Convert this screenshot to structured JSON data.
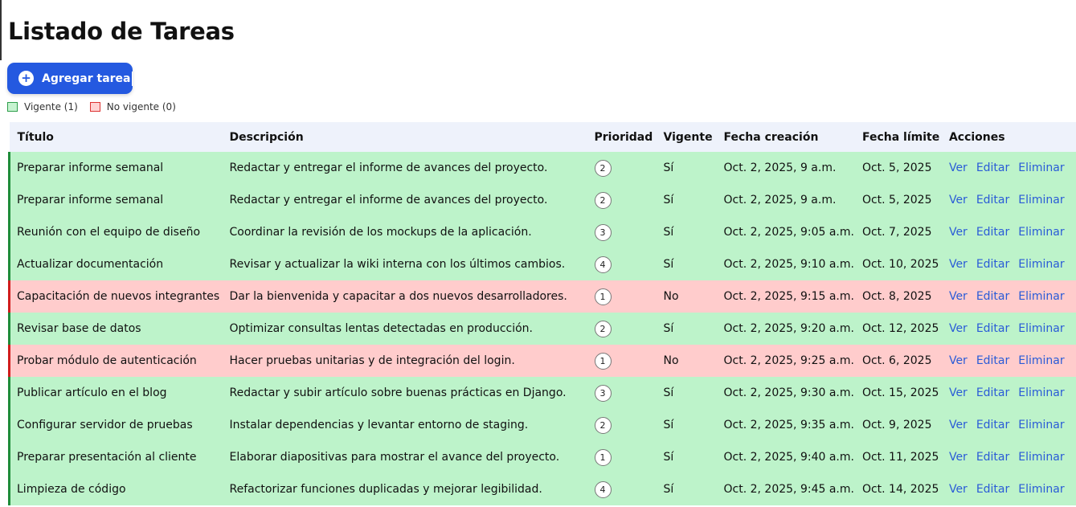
{
  "page": {
    "title": "Listado de Tareas"
  },
  "add_button": {
    "label": "Agregar tarea",
    "icon": "plus-circle-icon"
  },
  "legend": {
    "vigente": "Vigente (1)",
    "no_vigente": "No vigente (0)"
  },
  "colors": {
    "accent": "#2459e0",
    "vigente_bg": "#bdf3ca",
    "no_vigente_bg": "#ffcccc",
    "link": "#2a5bd7"
  },
  "table": {
    "headers": {
      "titulo": "Título",
      "descripcion": "Descripción",
      "prioridad": "Prioridad",
      "vigente": "Vigente",
      "fecha_creacion": "Fecha creación",
      "fecha_limite": "Fecha límite",
      "acciones": "Acciones"
    },
    "actions": {
      "ver": "Ver",
      "editar": "Editar",
      "eliminar": "Eliminar"
    },
    "rows": [
      {
        "titulo": "Preparar informe semanal",
        "descripcion": "Redactar y entregar el informe de avances del proyecto.",
        "prioridad": "2",
        "vigente": "Sí",
        "fecha_creacion": "Oct. 2, 2025, 9 a.m.",
        "fecha_limite": "Oct. 5, 2025",
        "estado": "green"
      },
      {
        "titulo": "Preparar informe semanal",
        "descripcion": "Redactar y entregar el informe de avances del proyecto.",
        "prioridad": "2",
        "vigente": "Sí",
        "fecha_creacion": "Oct. 2, 2025, 9 a.m.",
        "fecha_limite": "Oct. 5, 2025",
        "estado": "green"
      },
      {
        "titulo": "Reunión con el equipo de diseño",
        "descripcion": "Coordinar la revisión de los mockups de la aplicación.",
        "prioridad": "3",
        "vigente": "Sí",
        "fecha_creacion": "Oct. 2, 2025, 9:05 a.m.",
        "fecha_limite": "Oct. 7, 2025",
        "estado": "green"
      },
      {
        "titulo": "Actualizar documentación",
        "descripcion": "Revisar y actualizar la wiki interna con los últimos cambios.",
        "prioridad": "4",
        "vigente": "Sí",
        "fecha_creacion": "Oct. 2, 2025, 9:10 a.m.",
        "fecha_limite": "Oct. 10, 2025",
        "estado": "green"
      },
      {
        "titulo": "Capacitación de nuevos integrantes",
        "descripcion": "Dar la bienvenida y capacitar a dos nuevos desarrolladores.",
        "prioridad": "1",
        "vigente": "No",
        "fecha_creacion": "Oct. 2, 2025, 9:15 a.m.",
        "fecha_limite": "Oct. 8, 2025",
        "estado": "red"
      },
      {
        "titulo": "Revisar base de datos",
        "descripcion": "Optimizar consultas lentas detectadas en producción.",
        "prioridad": "2",
        "vigente": "Sí",
        "fecha_creacion": "Oct. 2, 2025, 9:20 a.m.",
        "fecha_limite": "Oct. 12, 2025",
        "estado": "green"
      },
      {
        "titulo": "Probar módulo de autenticación",
        "descripcion": "Hacer pruebas unitarias y de integración del login.",
        "prioridad": "1",
        "vigente": "No",
        "fecha_creacion": "Oct. 2, 2025, 9:25 a.m.",
        "fecha_limite": "Oct. 6, 2025",
        "estado": "red"
      },
      {
        "titulo": "Publicar artículo en el blog",
        "descripcion": "Redactar y subir artículo sobre buenas prácticas en Django.",
        "prioridad": "3",
        "vigente": "Sí",
        "fecha_creacion": "Oct. 2, 2025, 9:30 a.m.",
        "fecha_limite": "Oct. 15, 2025",
        "estado": "green"
      },
      {
        "titulo": "Configurar servidor de pruebas",
        "descripcion": "Instalar dependencias y levantar entorno de staging.",
        "prioridad": "2",
        "vigente": "Sí",
        "fecha_creacion": "Oct. 2, 2025, 9:35 a.m.",
        "fecha_limite": "Oct. 9, 2025",
        "estado": "green"
      },
      {
        "titulo": "Preparar presentación al cliente",
        "descripcion": "Elaborar diapositivas para mostrar el avance del proyecto.",
        "prioridad": "1",
        "vigente": "Sí",
        "fecha_creacion": "Oct. 2, 2025, 9:40 a.m.",
        "fecha_limite": "Oct. 11, 2025",
        "estado": "green"
      },
      {
        "titulo": "Limpieza de código",
        "descripcion": "Refactorizar funciones duplicadas y mejorar legibilidad.",
        "prioridad": "4",
        "vigente": "Sí",
        "fecha_creacion": "Oct. 2, 2025, 9:45 a.m.",
        "fecha_limite": "Oct. 14, 2025",
        "estado": "green"
      }
    ]
  }
}
